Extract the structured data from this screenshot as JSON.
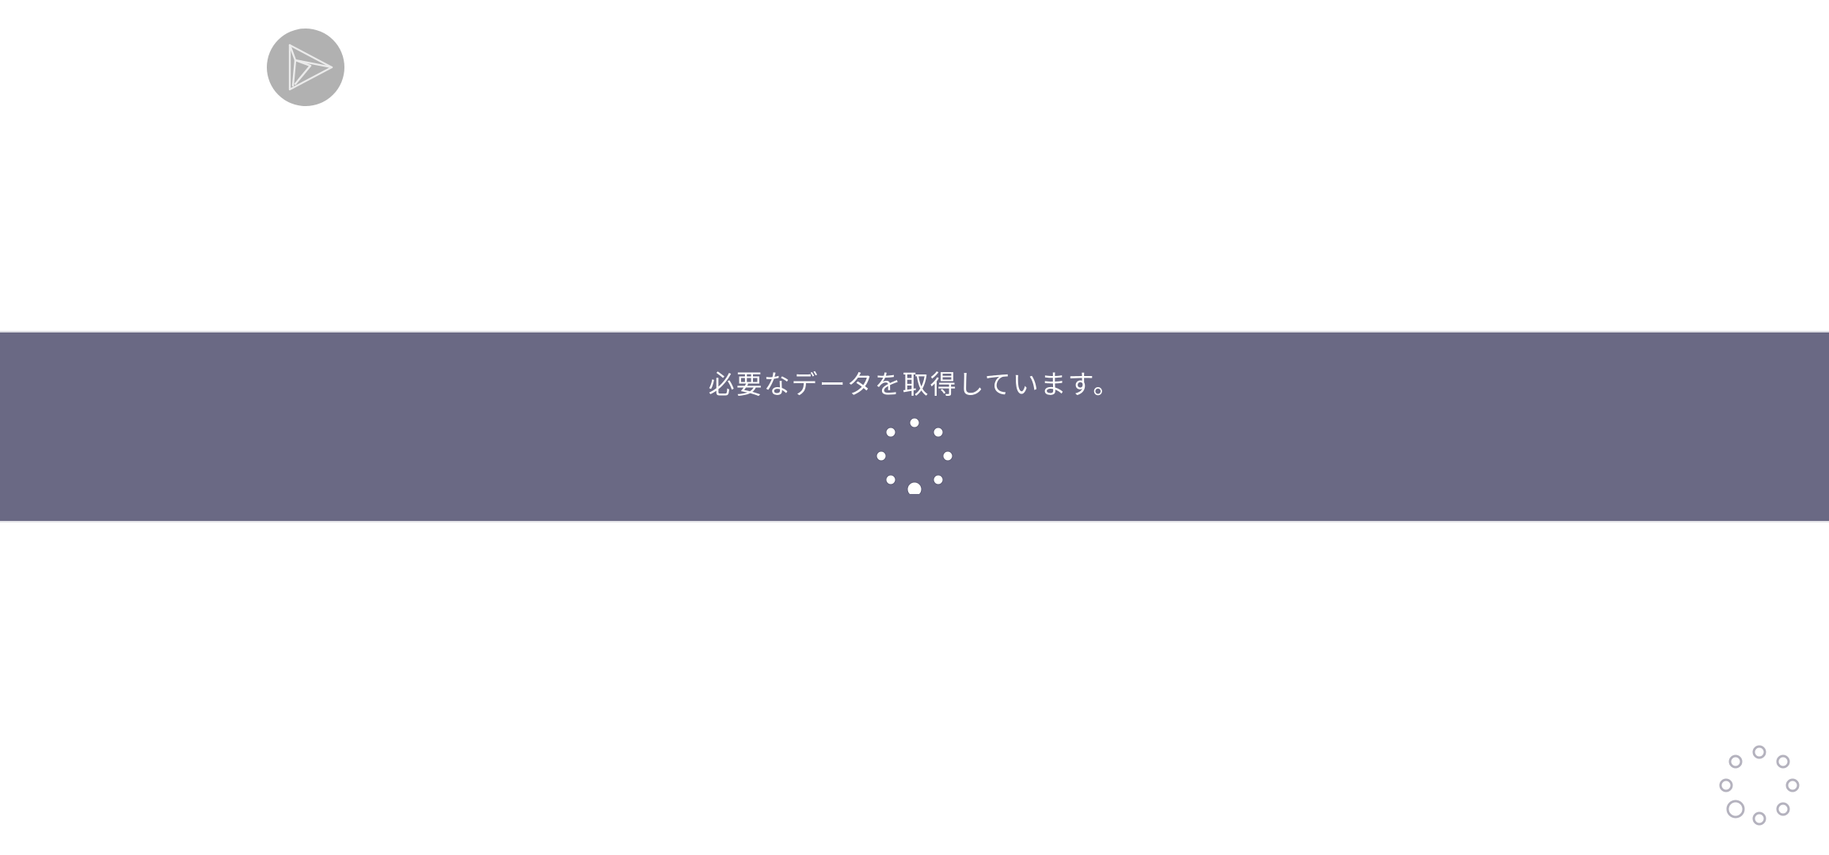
{
  "loading_banner": {
    "message": "必要なデータを取得しています。"
  },
  "icons": {
    "logo": "paper-plane-icon",
    "banner_spinner": "loading-spinner-icon",
    "corner_spinner": "loading-spinner-icon"
  },
  "colors": {
    "background": "#ffffff",
    "banner": "#6a6984",
    "logo_circle": "#b1b1b1",
    "logo_stroke": "#ebebeb",
    "banner_text": "#ffffff",
    "corner_spinner": "#b4b2be"
  }
}
